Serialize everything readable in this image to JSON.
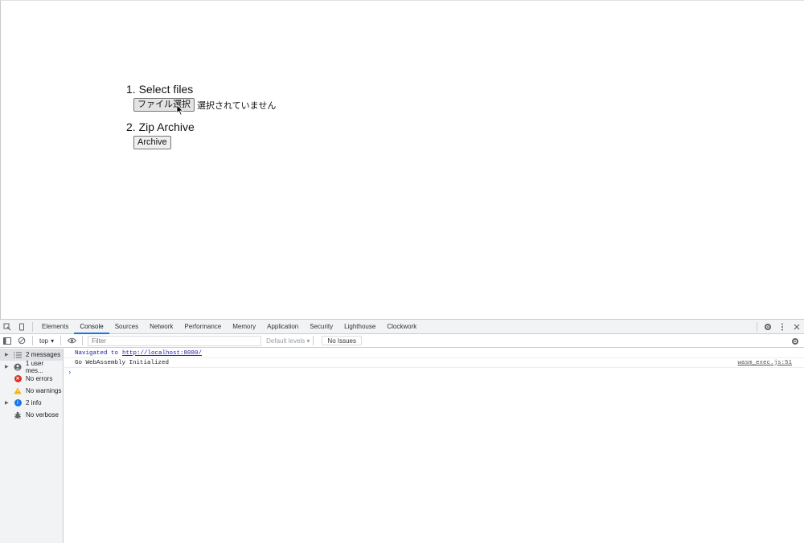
{
  "page": {
    "step1_title": "1. Select files",
    "file_button": "ファイル選択",
    "file_status": "選択されていません",
    "step2_title": "2. Zip Archive",
    "archive_button": "Archive"
  },
  "devtools": {
    "tabs": [
      "Elements",
      "Console",
      "Sources",
      "Network",
      "Performance",
      "Memory",
      "Application",
      "Security",
      "Lighthouse",
      "Clockwork"
    ],
    "active_tab": "Console",
    "context": "top",
    "filter_placeholder": "Filter",
    "default_levels": "Default levels",
    "no_issues": "No Issues",
    "sidebar": [
      {
        "label": "2 messages",
        "icon": "list-icon"
      },
      {
        "label": "1 user mes...",
        "icon": "user-icon"
      },
      {
        "label": "No errors",
        "icon": "error-icon"
      },
      {
        "label": "No warnings",
        "icon": "warning-icon"
      },
      {
        "label": "2 info",
        "icon": "info-icon"
      },
      {
        "label": "No verbose",
        "icon": "bug-icon"
      }
    ],
    "messages": {
      "nav_text": "Navigated to",
      "nav_url": "http://localhost:8080/",
      "log_text": "Go WebAssembly Initialized",
      "log_source": "wasm_exec.js:51"
    }
  },
  "colors": {
    "accent": "#1a73e8",
    "error": "#d93025",
    "warning": "#f9ab00",
    "info": "#1a73e8"
  }
}
